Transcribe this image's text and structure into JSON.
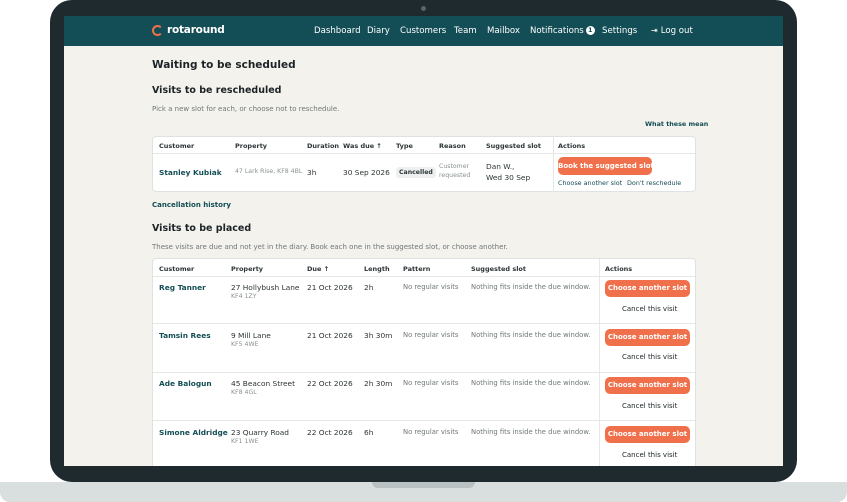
{
  "nav": {
    "brand": "rotaround",
    "items": [
      "Dashboard",
      "Diary",
      "Customers",
      "Team",
      "Mailbox",
      "Notifications",
      "Settings"
    ],
    "notifications_count": "1",
    "logout": "Log out"
  },
  "page_title": "Waiting to be scheduled",
  "reschedule": {
    "title": "Visits to be rescheduled",
    "subtitle": "Pick a new slot for each, or choose not to reschedule.",
    "help_link": "What these mean",
    "headers": [
      "Customer",
      "Property",
      "Duration",
      "Was due",
      "Type",
      "Reason",
      "Suggested slot",
      "Actions"
    ],
    "sort_arrow": "↑",
    "row": {
      "customer": "Stanley Kubiak",
      "property": "47 Lark Rise, KF8 4BL",
      "duration": "3h",
      "was_due": "30 Sep 2026",
      "type": "Cancelled",
      "reason_line1": "Customer",
      "reason_line2": "requested",
      "slot_line1": "Dan W.,",
      "slot_line2": "Wed 30 Sep",
      "book_button": "Book the suggested slot",
      "choose_link": "Choose another slot",
      "dont_link": "Don't reschedule"
    },
    "history_link": "Cancellation history"
  },
  "placed": {
    "title": "Visits to be placed",
    "subtitle": "These visits are due and not yet in the diary. Book each one in the suggested slot, or choose another.",
    "headers": [
      "Customer",
      "Property",
      "Due",
      "Length",
      "Pattern",
      "Suggested slot",
      "Actions"
    ],
    "sort_arrow": "↑",
    "choose_button": "Choose another slot",
    "cancel_link": "Cancel this visit",
    "rows": [
      {
        "customer": "Reg Tanner",
        "street": "27 Hollybush Lane",
        "postcode": "KF4 1ZY",
        "due": "21 Oct 2026",
        "length": "2h",
        "pattern": "No regular visits",
        "slot": "Nothing fits inside the due window."
      },
      {
        "customer": "Tamsin Rees",
        "street": "9 Mill Lane",
        "postcode": "KF5 4WE",
        "due": "21 Oct 2026",
        "length": "3h 30m",
        "pattern": "No regular visits",
        "slot": "Nothing fits inside the due window."
      },
      {
        "customer": "Ade Balogun",
        "street": "45 Beacon Street",
        "postcode": "KF8 4GL",
        "due": "22 Oct 2026",
        "length": "2h 30m",
        "pattern": "No regular visits",
        "slot": "Nothing fits inside the due window."
      },
      {
        "customer": "Simone Aldridge",
        "street": "23 Quarry Road",
        "postcode": "KF1 1WE",
        "due": "22 Oct 2026",
        "length": "6h",
        "pattern": "No regular visits",
        "slot": "Nothing fits inside the due window."
      }
    ]
  },
  "colors": {
    "nav": "#134d55",
    "accent": "#f0704b",
    "background": "#f4f2ed"
  }
}
